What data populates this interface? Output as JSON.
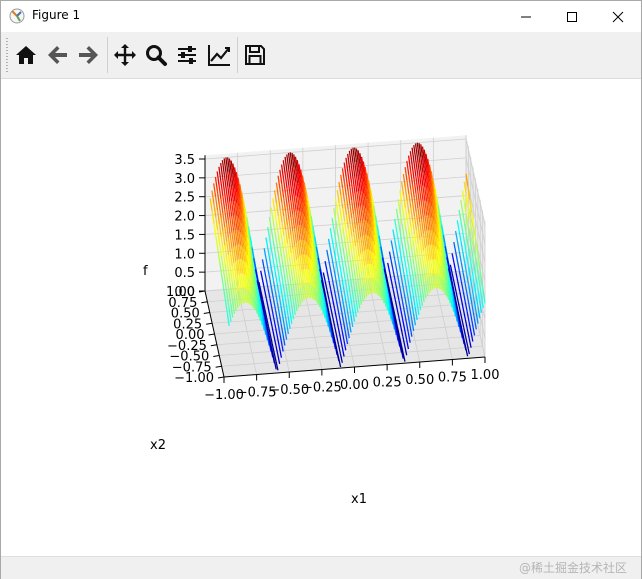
{
  "window": {
    "title": "Figure 1",
    "minimize_icon": "minimize-icon",
    "maximize_icon": "maximize-icon",
    "close_icon": "close-icon",
    "app_icon": "matplotlib-figure-icon"
  },
  "toolbar": {
    "buttons": [
      {
        "name": "home",
        "icon": "home-icon"
      },
      {
        "name": "back",
        "icon": "arrow-left-icon"
      },
      {
        "name": "forward",
        "icon": "arrow-right-icon"
      },
      {
        "name": "pan",
        "icon": "move-icon"
      },
      {
        "name": "zoom",
        "icon": "magnifier-icon"
      },
      {
        "name": "subplots",
        "icon": "sliders-icon"
      },
      {
        "name": "edit-axis",
        "icon": "line-chart-icon"
      },
      {
        "name": "save",
        "icon": "floppy-disk-icon"
      }
    ]
  },
  "chart_data": {
    "type": "surface3d-lines",
    "title": "",
    "xlabel": "x1",
    "ylabel": "x2",
    "zlabel": "f",
    "x_ticks": [
      "−1.00",
      "−0.75",
      "−0.50",
      "−0.25",
      "0.00",
      "0.25",
      "0.50",
      "0.75",
      "1.00"
    ],
    "y_ticks": [
      "1.00",
      "0.75",
      "0.50",
      "0.25",
      "0.00",
      "−0.25",
      "−0.50",
      "−0.75",
      "−1.00"
    ],
    "z_ticks": [
      "3.5",
      "3.0",
      "2.5",
      "2.0",
      "1.5",
      "1.0",
      "0.5",
      "0.0"
    ],
    "xlim": [
      -1,
      1
    ],
    "ylim": [
      -1,
      1
    ],
    "zlim": [
      0,
      3.5
    ],
    "colormap": "jet",
    "grid": true
  },
  "status": {
    "watermark": "@稀土掘金技术社区"
  }
}
